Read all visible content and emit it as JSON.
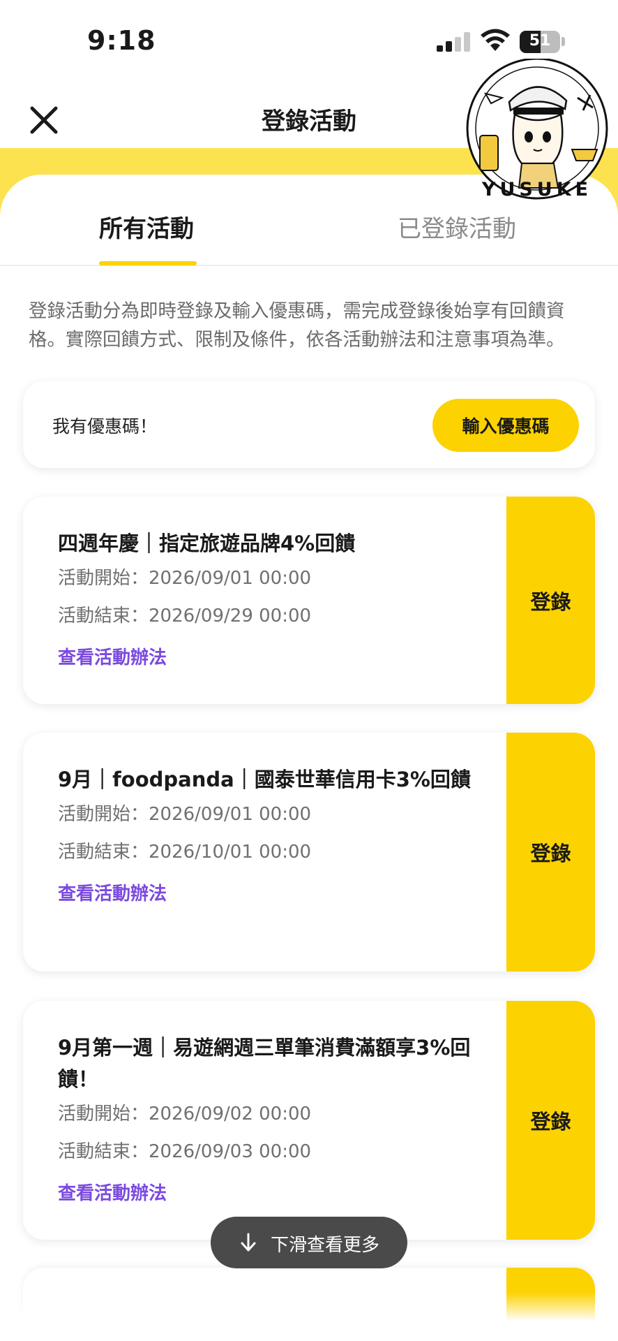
{
  "status_bar": {
    "time": "9:18",
    "battery": "51",
    "battery_level": 0.51
  },
  "header": {
    "title": "登錄活動",
    "close_icon": "close-icon"
  },
  "tabs": [
    {
      "label": "所有活動",
      "active": true
    },
    {
      "label": "已登錄活動",
      "active": false
    }
  ],
  "intro": "登錄活動分為即時登錄及輸入優惠碼，需完成登錄後始享有回饋資格。實際回饋方式、限制及條件，依各活動辦法和注意事項為準。",
  "promo": {
    "label": "我有優惠碼！",
    "button": "輸入優惠碼"
  },
  "activities": [
    {
      "title": "四週年慶｜指定旅遊品牌4%回饋",
      "start": "活動開始：2026/09/01 00:00",
      "end": "活動結束：2026/09/29 00:00",
      "link": "查看活動辦法",
      "button": "登錄"
    },
    {
      "title": "9月｜foodpanda｜國泰世華信用卡3%回饋",
      "start": "活動開始：2026/09/01 00:00",
      "end": "活動結束：2026/10/01 00:00",
      "link": "查看活動辦法",
      "button": "登錄"
    },
    {
      "title": "9月第一週｜易遊網週三單筆消費滿額享3%回饋！",
      "start": "活動開始：2026/09/02 00:00",
      "end": "活動結束：2026/09/03 00:00",
      "link": "查看活動辦法",
      "button": "登錄"
    }
  ],
  "scroll_hint": {
    "label": "下滑查看更多",
    "icon": "arrow-down-icon"
  },
  "sticker": {
    "text": "YUSUKE"
  },
  "colors": {
    "accent": "#fcd200",
    "header_band": "#fde24f",
    "link": "#7b4ae0",
    "text_muted": "#707070"
  }
}
